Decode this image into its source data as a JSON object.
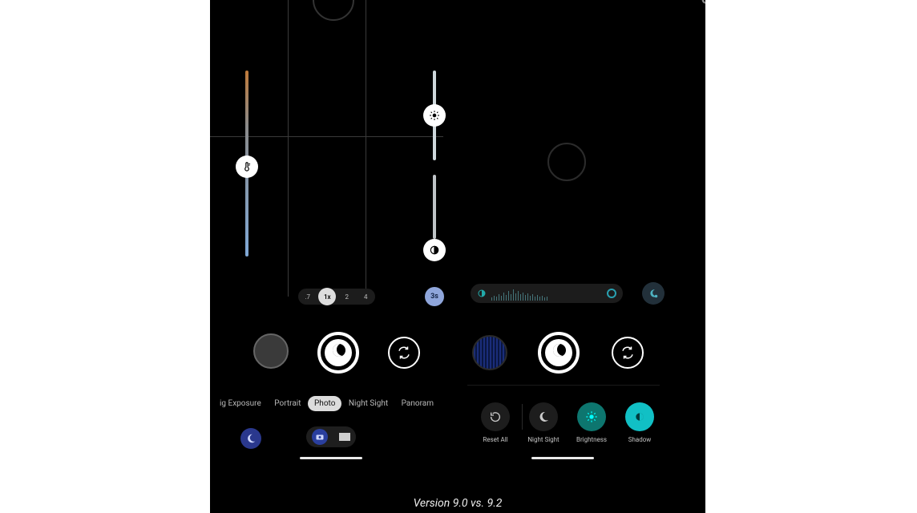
{
  "caption": "Version 9.0 vs. 9.2",
  "left_screen": {
    "zoom": {
      "levels": [
        ".7",
        "1x",
        "2",
        "4"
      ],
      "active_index": 1
    },
    "timer_label": "3s",
    "modes": {
      "items": [
        "ig Exposure",
        "Portrait",
        "Photo",
        "Night Sight",
        "Panoram"
      ],
      "active_index": 2
    },
    "sliders": {
      "white_balance": {
        "icon": "thermometer-icon"
      },
      "brightness": {
        "icon": "sun-icon"
      },
      "shadow": {
        "icon": "half-circle-icon"
      }
    },
    "photo_video_toggle": {
      "active": "photo"
    }
  },
  "right_screen": {
    "tools": {
      "reset": {
        "label": "Reset All",
        "icon": "reset-icon"
      },
      "night": {
        "label": "Night Sight",
        "icon": "moon-icon"
      },
      "brightness": {
        "label": "Brightness",
        "icon": "sun-icon"
      },
      "shadow": {
        "label": "Shadow",
        "icon": "half-circle-icon"
      }
    }
  },
  "colors": {
    "timer_chip": "#8fa6db",
    "ns_blue": "#2a388d",
    "tool_teal": "#0d766f",
    "tool_cyan": "#11c0c5",
    "tick_cyan": "#45757a"
  }
}
